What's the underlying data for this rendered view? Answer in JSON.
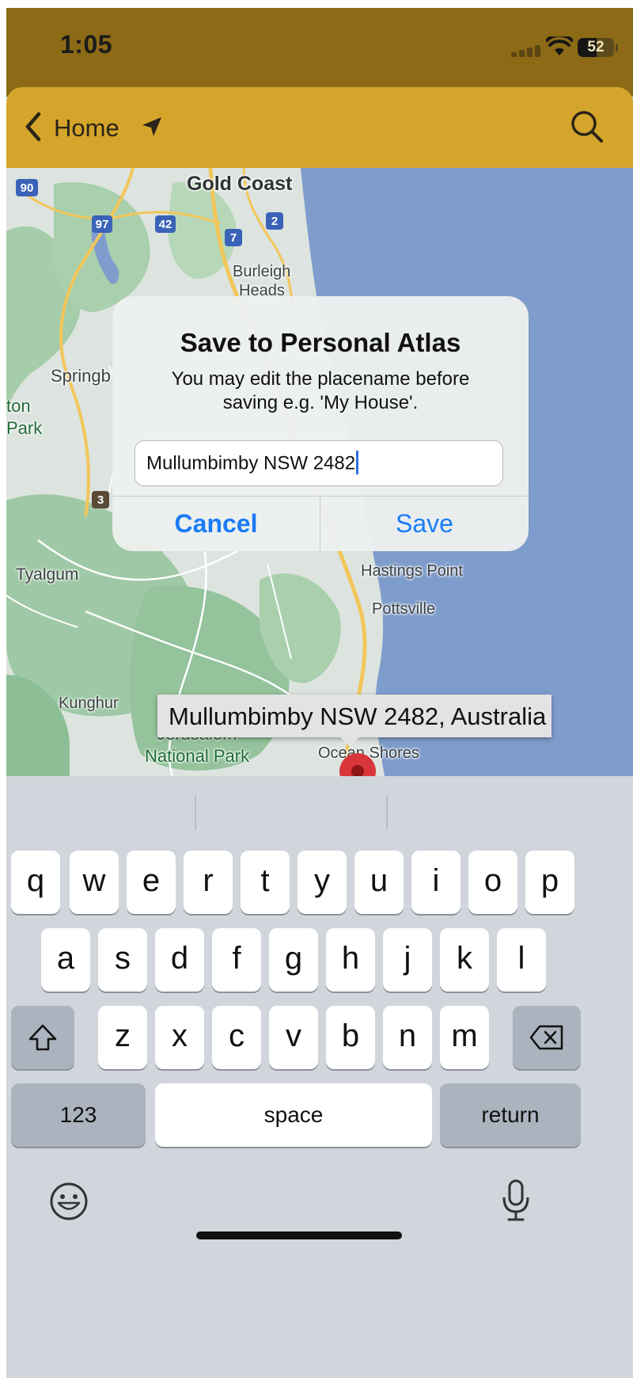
{
  "status_bar": {
    "time": "1:05",
    "battery": "52"
  },
  "nav": {
    "back_label": "Home"
  },
  "map": {
    "labels": [
      {
        "id": "gold-coast",
        "text": "Gold Coast"
      },
      {
        "id": "burleigh",
        "text": "Burleigh"
      },
      {
        "id": "heads",
        "text": "Heads"
      },
      {
        "id": "springbrook",
        "text": "Springb"
      },
      {
        "id": "ton",
        "text": "ton"
      },
      {
        "id": "park-left",
        "text": "Park"
      },
      {
        "id": "tyalgum",
        "text": "Tyalgum"
      },
      {
        "id": "hastings-point",
        "text": "Hastings Point"
      },
      {
        "id": "pottsville",
        "text": "Pottsville"
      },
      {
        "id": "kunghur",
        "text": "Kunghur"
      },
      {
        "id": "jerusalem",
        "text": "Jerusalem"
      },
      {
        "id": "national-park",
        "text": "National Park"
      },
      {
        "id": "ocean-shores",
        "text": "Ocean Shores"
      }
    ],
    "road_shields": [
      "90",
      "97",
      "42",
      "7",
      "2",
      "3"
    ],
    "callout": "Mullumbimby NSW 2482, Australia"
  },
  "dialog": {
    "title": "Save to Personal Atlas",
    "message_line1": "You may edit the placename before",
    "message_line2": "saving e.g. 'My House'.",
    "input_value": "Mullumbimby NSW 2482",
    "cancel": "Cancel",
    "save": "Save"
  },
  "keyboard": {
    "row1": [
      "q",
      "w",
      "e",
      "r",
      "t",
      "y",
      "u",
      "i",
      "o",
      "p"
    ],
    "row2": [
      "a",
      "s",
      "d",
      "f",
      "g",
      "h",
      "j",
      "k",
      "l"
    ],
    "row3": [
      "z",
      "x",
      "c",
      "v",
      "b",
      "n",
      "m"
    ],
    "numbers": "123",
    "space": "space",
    "return": "return"
  },
  "colors": {
    "status_bar": "#8c6a16",
    "nav_bar": "#d4a52a",
    "water": "#7f9dcc",
    "land": "#dde4df",
    "forest": "#9fc9a6",
    "accent": "#1a7cf5"
  }
}
